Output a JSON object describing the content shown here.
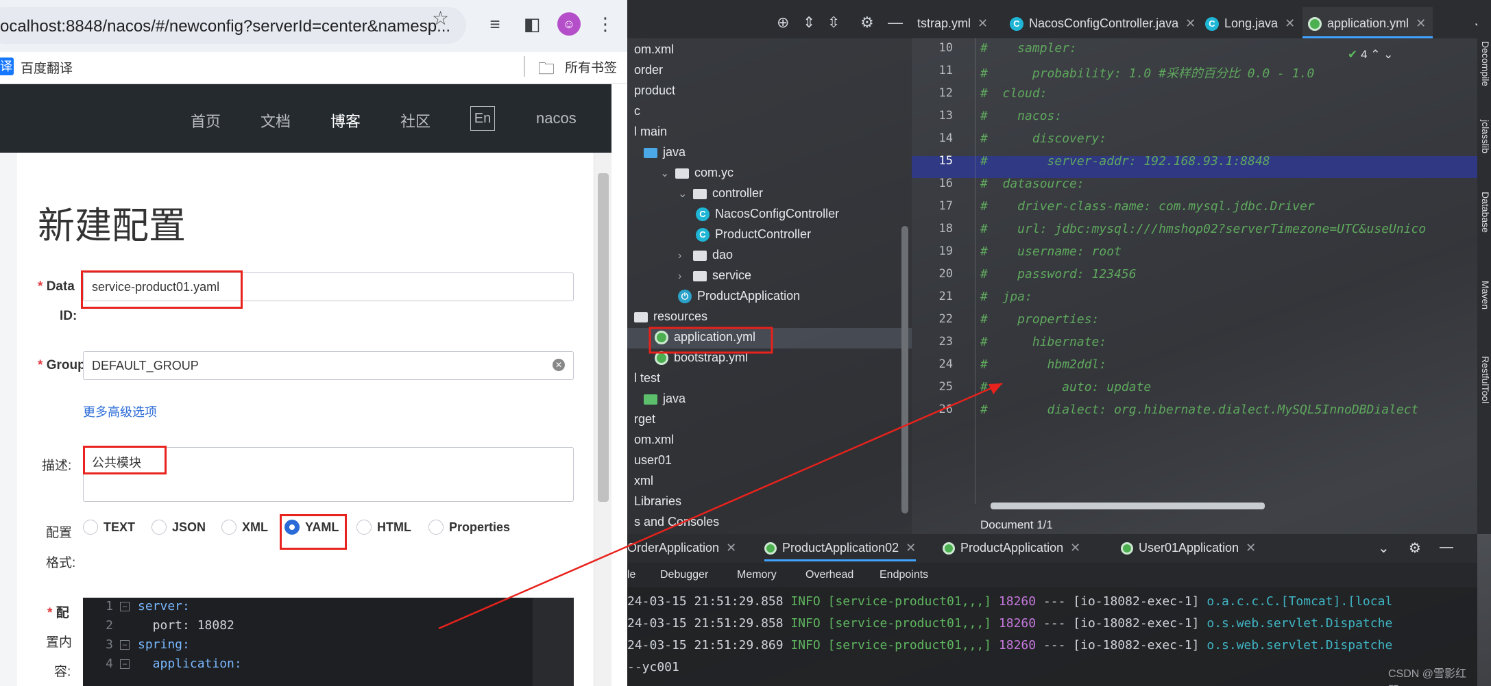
{
  "browser": {
    "url": "ocalhost:8848/nacos/#/newconfig?serverId=center&namesp...",
    "bookmarks": {
      "fanyi_badge": "译",
      "fanyi_label": "百度翻译",
      "all_bookmarks": "所有书签"
    },
    "icons": [
      "star-icon",
      "media-control-icon",
      "sidebar-toggle-icon",
      "profile-avatar-icon",
      "menu-dots-icon",
      "folder-icon"
    ]
  },
  "nacos": {
    "nav": {
      "home": "首页",
      "docs": "文档",
      "blog": "博客",
      "community": "社区",
      "lang": "En",
      "brand": "nacos"
    },
    "page_title": "新建配置",
    "form": {
      "data_id_label": "Data",
      "data_id_label2": "ID:",
      "data_id_value": "service-product01.yaml",
      "group_label": "Group",
      "group_value": "DEFAULT_GROUP",
      "advanced_link": "更多高级选项",
      "desc_label": "描述:",
      "desc_value": "公共模块",
      "format_label_1": "配置",
      "format_label_2": "格式:",
      "formats": [
        "TEXT",
        "JSON",
        "XML",
        "YAML",
        "HTML",
        "Properties"
      ],
      "selected_format": "YAML",
      "content_label_1": "配",
      "content_label_2": "置内",
      "content_label_3": "容:",
      "required_mark": "*"
    },
    "code": [
      {
        "n": "1",
        "text": "server:"
      },
      {
        "n": "2",
        "text": "  port: 18082"
      },
      {
        "n": "3",
        "text": "spring:"
      },
      {
        "n": "4",
        "text": "  application:"
      }
    ]
  },
  "ide": {
    "project_tree": [
      {
        "label": "om.xml",
        "icon": "none"
      },
      {
        "label": "order",
        "icon": "none"
      },
      {
        "label": "product",
        "icon": "none"
      },
      {
        "label": "c",
        "icon": "none"
      },
      {
        "label": "l main",
        "icon": "none"
      },
      {
        "label": "java",
        "icon": "folder-blue"
      },
      {
        "label": "com.yc",
        "icon": "folder"
      },
      {
        "label": "controller",
        "icon": "folder"
      },
      {
        "label": "NacosConfigController",
        "icon": "class"
      },
      {
        "label": "ProductController",
        "icon": "class"
      },
      {
        "label": "dao",
        "icon": "folder"
      },
      {
        "label": "service",
        "icon": "folder"
      },
      {
        "label": "ProductApplication",
        "icon": "spring"
      },
      {
        "label": "resources",
        "icon": "folder"
      },
      {
        "label": "application.yml",
        "icon": "leaf"
      },
      {
        "label": "bootstrap.yml",
        "icon": "leaf"
      },
      {
        "label": "l test",
        "icon": "none"
      },
      {
        "label": "java",
        "icon": "folder-green"
      },
      {
        "label": "rget",
        "icon": "none"
      },
      {
        "label": "om.xml",
        "icon": "none"
      },
      {
        "label": "user01",
        "icon": "none"
      },
      {
        "label": "xml",
        "icon": "none"
      },
      {
        "label": "Libraries",
        "icon": "none"
      },
      {
        "label": "s and Consoles",
        "icon": "none"
      }
    ],
    "editor_tabs": [
      {
        "label": "tstrap.yml",
        "icon": "none",
        "active": false
      },
      {
        "label": "NacosConfigController.java",
        "icon": "class",
        "active": false
      },
      {
        "label": "Long.java",
        "icon": "class",
        "active": false
      },
      {
        "label": "application.yml",
        "icon": "leaf",
        "active": true
      }
    ],
    "inspection_count": "4",
    "editor_lines": [
      {
        "n": "10",
        "text": "#    sampler:"
      },
      {
        "n": "11",
        "text": "#      probability: 1.0 #采样的百分比 0.0 - 1.0"
      },
      {
        "n": "12",
        "text": "#  cloud:"
      },
      {
        "n": "13",
        "text": "#    nacos:"
      },
      {
        "n": "14",
        "text": "#      discovery:"
      },
      {
        "n": "15",
        "text": "#        server-addr: 192.168.93.1:8848"
      },
      {
        "n": "16",
        "text": "#  datasource:"
      },
      {
        "n": "17",
        "text": "#    driver-class-name: com.mysql.jdbc.Driver"
      },
      {
        "n": "18",
        "text": "#    url: jdbc:mysql:///hmshop02?serverTimezone=UTC&useUnico"
      },
      {
        "n": "19",
        "text": "#    username: root"
      },
      {
        "n": "20",
        "text": "#    password: 123456"
      },
      {
        "n": "21",
        "text": "#  jpa:"
      },
      {
        "n": "22",
        "text": "#    properties:"
      },
      {
        "n": "23",
        "text": "#      hibernate:"
      },
      {
        "n": "24",
        "text": "#        hbm2ddl:"
      },
      {
        "n": "25",
        "text": "#          auto: update"
      },
      {
        "n": "26",
        "text": "#        dialect: org.hibernate.dialect.MySQL5InnoDBDialect"
      }
    ],
    "breadcrumb": "Document 1/1",
    "right_strip": [
      "Decompile",
      "jclasslib",
      "Database",
      "Maven",
      "RestfulTool"
    ],
    "run_tabs": [
      {
        "label": "OrderApplication",
        "active": false
      },
      {
        "label": "ProductApplication02",
        "active": true
      },
      {
        "label": "ProductApplication",
        "active": false
      },
      {
        "label": "User01Application",
        "active": false
      }
    ],
    "run_subtabs": [
      "le",
      "Debugger",
      "Memory",
      "Overhead",
      "Endpoints"
    ],
    "logs": [
      {
        "date": "24-03-15 21:51:29.858",
        "level": "INFO",
        "ctx": "[service-product01,,,]",
        "pid": "18260",
        "sep": "---",
        "thread": "[io-18082-exec-1]",
        "cls": "o.a.c.c.C.[Tomcat].[local"
      },
      {
        "date": "24-03-15 21:51:29.858",
        "level": "INFO",
        "ctx": "[service-product01,,,]",
        "pid": "18260",
        "sep": "---",
        "thread": "[io-18082-exec-1]",
        "cls": "o.s.web.servlet.Dispatche"
      },
      {
        "date": "24-03-15 21:51:29.869",
        "level": "INFO",
        "ctx": "[service-product01,,,]",
        "pid": "18260",
        "sep": "---",
        "thread": "[io-18082-exec-1]",
        "cls": "o.s.web.servlet.Dispatche"
      }
    ],
    "log_tail": "--yc001",
    "watermark": "CSDN @雪影红双"
  },
  "colors": {
    "annotation_red": "#e8221c",
    "nacos_nav_bg": "#252a2f",
    "link_blue": "#2b6bd8",
    "yaml_comment_green": "#5fa85d",
    "log_info_green": "#5fb65f",
    "log_pid_purple": "#c678dd"
  }
}
